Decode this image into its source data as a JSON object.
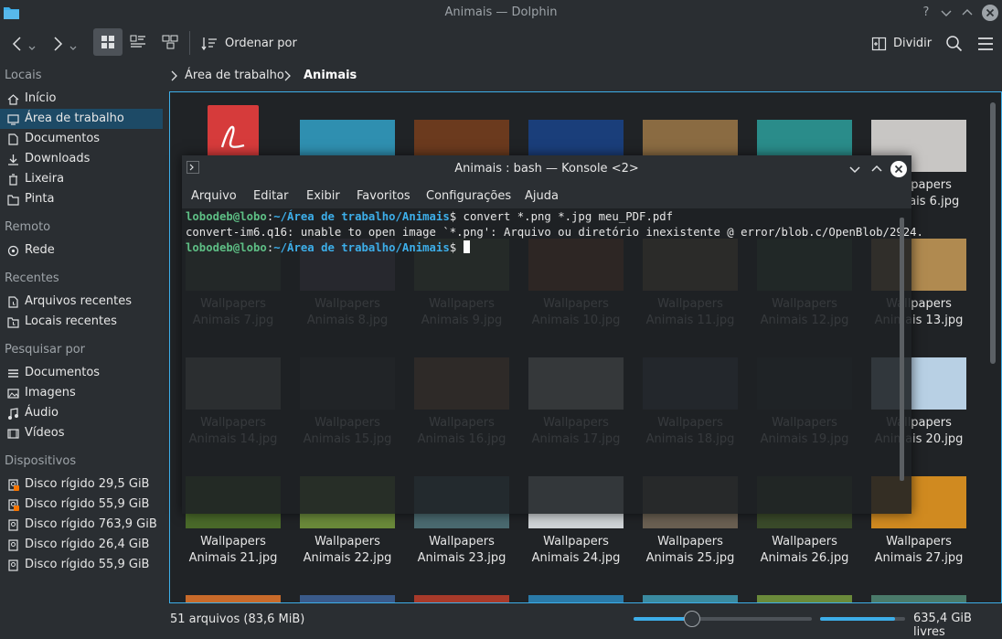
{
  "window": {
    "title": "Animais — Dolphin",
    "controls": [
      "help-icon",
      "chevron-down-icon",
      "chevron-up-icon",
      "close-icon"
    ]
  },
  "toolbar": {
    "sort_label": "Ordenar por",
    "split_label": "Dividir"
  },
  "sidebar": {
    "sections": [
      {
        "heading": "Locais",
        "items": [
          {
            "label": "Início",
            "icon": "home-icon"
          },
          {
            "label": "Área de trabalho",
            "icon": "desktop-icon",
            "selected": true
          },
          {
            "label": "Documentos",
            "icon": "documents-icon"
          },
          {
            "label": "Downloads",
            "icon": "download-icon"
          },
          {
            "label": "Lixeira",
            "icon": "trash-icon"
          },
          {
            "label": "Pinta",
            "icon": "folder-icon"
          }
        ]
      },
      {
        "heading": "Remoto",
        "items": [
          {
            "label": "Rede",
            "icon": "network-icon"
          }
        ]
      },
      {
        "heading": "Recentes",
        "items": [
          {
            "label": "Arquivos recentes",
            "icon": "recent-files-icon"
          },
          {
            "label": "Locais recentes",
            "icon": "recent-places-icon"
          }
        ]
      },
      {
        "heading": "Pesquisar por",
        "items": [
          {
            "label": "Documentos",
            "icon": "documents-list-icon"
          },
          {
            "label": "Imagens",
            "icon": "images-icon"
          },
          {
            "label": "Áudio",
            "icon": "music-icon"
          },
          {
            "label": "Vídeos",
            "icon": "video-icon"
          }
        ]
      },
      {
        "heading": "Dispositivos",
        "items": [
          {
            "label": "Disco rígido 29,5 GiB",
            "icon": "harddisk-icon"
          },
          {
            "label": "Disco rígido 55,9 GiB",
            "icon": "harddisk-icon"
          },
          {
            "label": "Disco rígido 763,9 GiB",
            "icon": "harddisk-icon"
          },
          {
            "label": "Disco rígido 26,4 GiB",
            "icon": "harddisk-icon"
          },
          {
            "label": "Disco rígido 55,9 GiB",
            "icon": "harddisk-icon"
          }
        ]
      }
    ]
  },
  "breadcrumb": [
    "Área de trabalho",
    "Animais"
  ],
  "files": {
    "rows": [
      [
        {
          "name": [
            "",
            ""
          ],
          "color": "#d63b3b",
          "kind": "pdf"
        },
        {
          "name": [
            "",
            ""
          ],
          "color": "#2f8fb0"
        },
        {
          "name": [
            "",
            ""
          ],
          "color": "#6b3a1e"
        },
        {
          "name": [
            "",
            ""
          ],
          "color": "#1a3e7a"
        },
        {
          "name": [
            "",
            ""
          ],
          "color": "#8a6b42"
        },
        {
          "name": [
            "",
            ""
          ],
          "color": "#2a8c8a"
        },
        {
          "name": [
            "Wallpapers",
            "Animais 6.jpg"
          ],
          "color": "#c8c6c4"
        }
      ],
      [
        {
          "name": [
            "Wallpapers",
            "Animais 7.jpg"
          ],
          "color": "#4e5a40"
        },
        {
          "name": [
            "Wallpapers",
            "Animais 8.jpg"
          ],
          "color": "#6a5e70"
        },
        {
          "name": [
            "Wallpapers",
            "Animais 9.jpg"
          ],
          "color": "#5e6a46"
        },
        {
          "name": [
            "Wallpapers",
            "Animais 10.jpg"
          ],
          "color": "#9a4a20"
        },
        {
          "name": [
            "Wallpapers",
            "Animais 11.jpg"
          ],
          "color": "#8a7448"
        },
        {
          "name": [
            "Wallpapers",
            "Animais 12.jpg"
          ],
          "color": "#3a5a3a"
        },
        {
          "name": [
            "Wallpapers",
            "Animais 13.jpg"
          ],
          "color": "#b08a50"
        }
      ],
      [
        {
          "name": [
            "Wallpapers",
            "Animais 14.jpg"
          ],
          "color": "#8a8a86"
        },
        {
          "name": [
            "Wallpapers",
            "Animais 15.jpg"
          ],
          "color": "#3a3a3a"
        },
        {
          "name": [
            "Wallpapers",
            "Animais 16.jpg"
          ],
          "color": "#a06a40"
        },
        {
          "name": [
            "Wallpapers",
            "Animais 17.jpg"
          ],
          "color": "#d8d8d6"
        },
        {
          "name": [
            "Wallpapers",
            "Animais 18.jpg"
          ],
          "color": "#4a5260"
        },
        {
          "name": [
            "Wallpapers",
            "Animais 19.jpg"
          ],
          "color": "#2e3032"
        },
        {
          "name": [
            "Wallpapers",
            "Animais 20.jpg"
          ],
          "color": "#b8d0e4"
        }
      ],
      [
        {
          "name": [
            "Wallpapers",
            "Animais 21.jpg"
          ],
          "color": "#4a6a2a"
        },
        {
          "name": [
            "Wallpapers",
            "Animais 22.jpg"
          ],
          "color": "#6a8a3a"
        },
        {
          "name": [
            "Wallpapers",
            "Animais 23.jpg"
          ],
          "color": "#4a6a70"
        },
        {
          "name": [
            "Wallpapers",
            "Animais 24.jpg"
          ],
          "color": "#cfd3d6"
        },
        {
          "name": [
            "Wallpapers",
            "Animais 25.jpg"
          ],
          "color": "#6a6052"
        },
        {
          "name": [
            "Wallpapers",
            "Animais 26.jpg"
          ],
          "color": "#3a4a2a"
        },
        {
          "name": [
            "Wallpapers",
            "Animais 27.jpg"
          ],
          "color": "#d08a20"
        }
      ],
      [
        {
          "name": [
            "",
            ""
          ],
          "color": "#c86a2a"
        },
        {
          "name": [
            "",
            ""
          ],
          "color": "#3a5a8a"
        },
        {
          "name": [
            "",
            ""
          ],
          "color": "#a83a2a"
        },
        {
          "name": [
            "",
            ""
          ],
          "color": "#2a7aa8"
        },
        {
          "name": [
            "",
            ""
          ],
          "color": "#3a8aa0"
        },
        {
          "name": [
            "",
            ""
          ],
          "color": "#6a8a3a"
        },
        {
          "name": [
            "",
            ""
          ],
          "color": "#4a7a6a"
        }
      ]
    ]
  },
  "konsole": {
    "title": "Animais : bash — Konsole <2>",
    "menu": [
      "Arquivo",
      "Editar",
      "Exibir",
      "Favoritos",
      "Configurações",
      "Ajuda"
    ],
    "lines": [
      {
        "user": "lobodeb@lobo",
        "sep": ":",
        "path": "~/Área de trabalho/Animais",
        "cmd": "$ convert *.png *.jpg meu_PDF.pdf"
      },
      {
        "text": "convert-im6.q16: unable to open image `*.png': Arquivo ou diretório inexistente @ error/blob.c/OpenBlob/2924."
      },
      {
        "user": "lobodeb@lobo",
        "sep": ":",
        "path": "~/Área de trabalho/Animais",
        "cmd": "$ "
      }
    ]
  },
  "status": {
    "summary": "51 arquivos (83,6 MiB)",
    "free_space": "635,4 GiB livres",
    "zoom_fraction": 0.33,
    "used_fraction": 0.88
  },
  "colors": {
    "accent": "#3daee9",
    "selection": "#1d4a66",
    "background": "#2a2e32",
    "view_background": "#202326"
  }
}
